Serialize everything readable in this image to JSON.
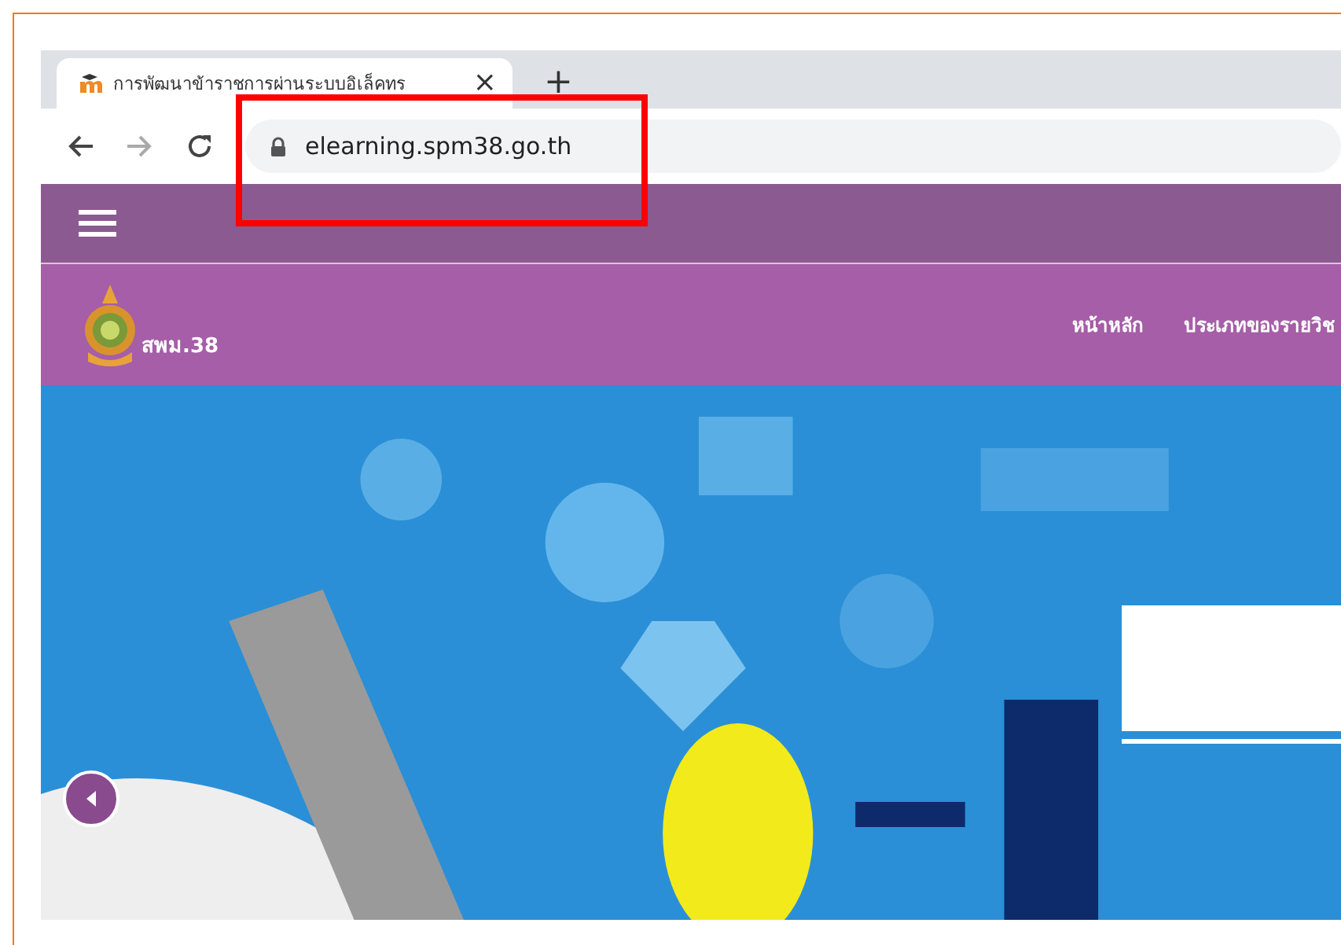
{
  "browser": {
    "tab": {
      "title": "การพัฒนาข้าราชการผ่านระบบอิเล็คทร",
      "close": "×"
    },
    "new_tab": "+",
    "address": {
      "url": "elearning.spm38.go.th"
    }
  },
  "site": {
    "logo_text": "สพม.38",
    "nav": [
      {
        "label": "หน้าหลัก"
      },
      {
        "label": "ประเภทของรายวิช"
      }
    ]
  }
}
